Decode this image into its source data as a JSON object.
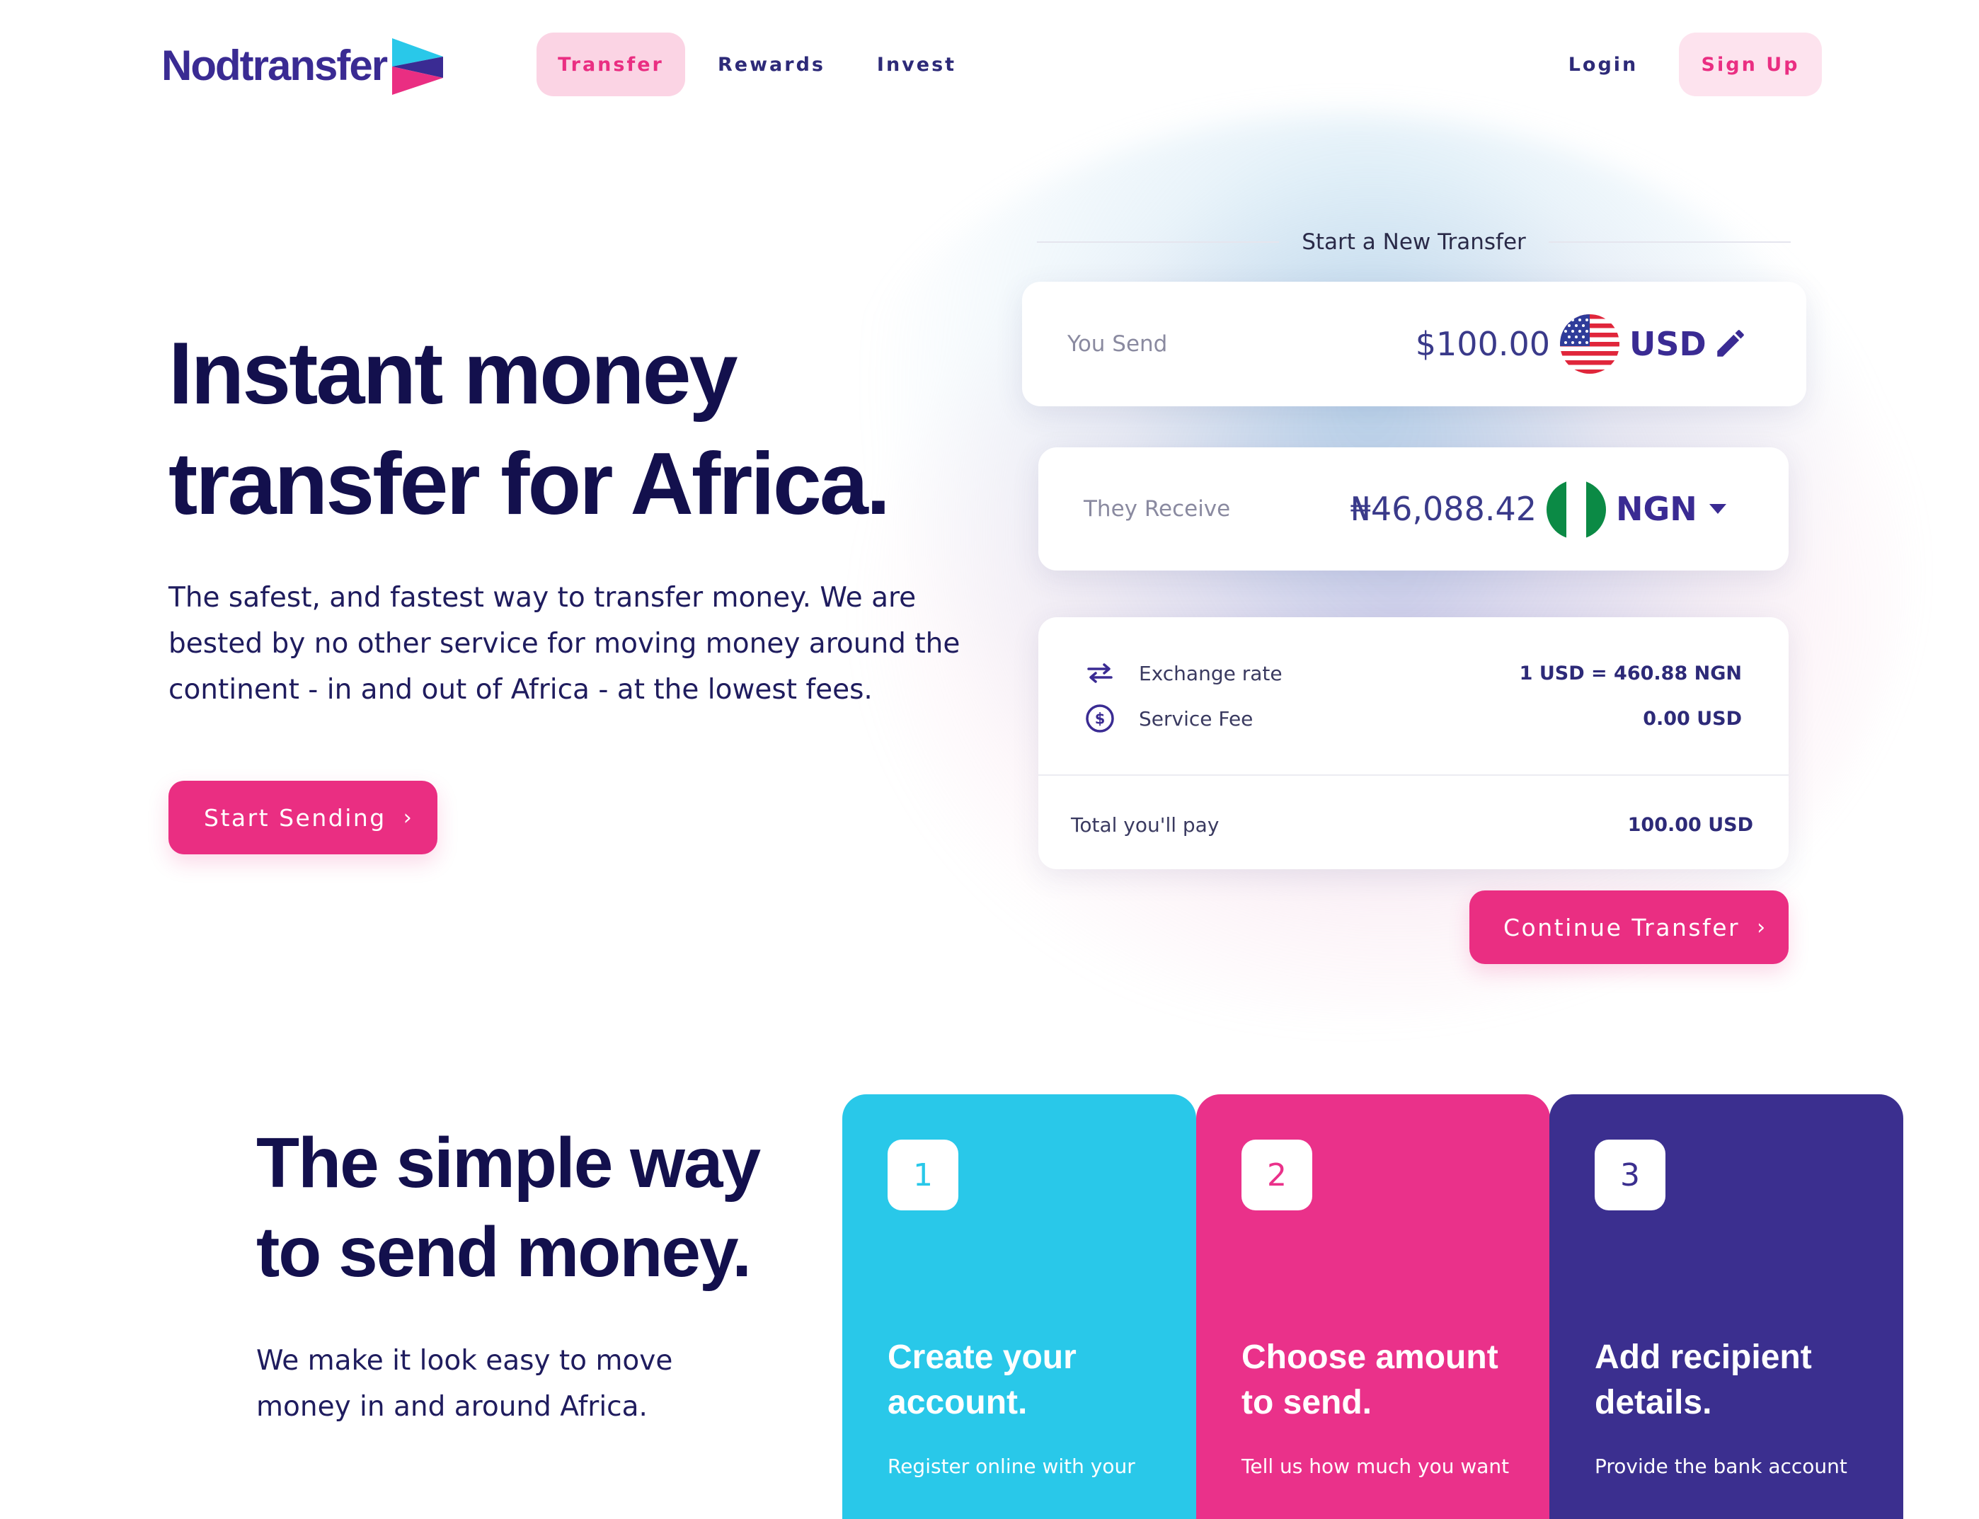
{
  "nav": {
    "logo": "Nodtransfer",
    "links": [
      "Transfer",
      "Rewards",
      "Invest"
    ],
    "active_link": "Transfer",
    "login": "Login",
    "signup": "Sign Up"
  },
  "hero": {
    "title_line1": "Instant money",
    "title_line2": "transfer for Africa.",
    "description": "The safest, and fastest way to transfer money. We are bested by no other service for moving money around the continent - in and out of Africa - at the lowest fees.",
    "cta": "Start Sending",
    "cta_icon": "chevron-right-icon"
  },
  "transfer": {
    "heading": "Start a New Transfer",
    "send": {
      "label": "You Send",
      "amount": "$100.00",
      "currency": "USD",
      "flag": "us-flag-icon",
      "action_icon": "pencil-icon"
    },
    "receive": {
      "label": "They Receive",
      "amount": "₦46,088.42",
      "currency": "NGN",
      "flag": "ng-flag-icon",
      "action_icon": "caret-down-icon"
    },
    "exchange_rate": {
      "label": "Exchange rate",
      "value": "1 USD = 460.88 NGN",
      "icon": "swap-arrows-icon"
    },
    "service_fee": {
      "label": "Service Fee",
      "value": "0.00 USD",
      "icon": "dollar-circle-icon"
    },
    "total": {
      "label": "Total you'll pay",
      "value": "100.00 USD"
    },
    "cta": "Continue Transfer"
  },
  "steps_section": {
    "title_line1": "The simple way",
    "title_line2": "to send money.",
    "description": "We make it look easy to move money in and around Africa.",
    "steps": [
      {
        "number": "1",
        "title_line1": "Create your",
        "title_line2": "account.",
        "text": "Register online with your",
        "color": "#29c8e9"
      },
      {
        "number": "2",
        "title_line1": "Choose amount",
        "title_line2": "to send.",
        "text": "Tell us how much you want",
        "color": "#ea318a"
      },
      {
        "number": "3",
        "title_line1": "Add recipient",
        "title_line2": "details.",
        "text": "Provide the bank account",
        "color": "#3b2f8f"
      }
    ]
  },
  "colors": {
    "brand_pink": "#ea2e82",
    "brand_purple": "#3a2b93",
    "navy_text": "#13104d",
    "step_cyan": "#29c8e9"
  }
}
